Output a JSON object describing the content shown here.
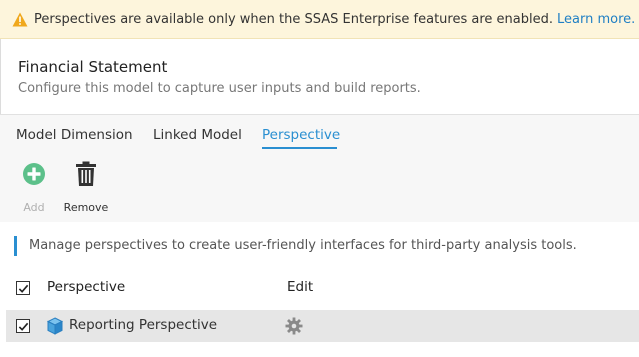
{
  "banner": {
    "icon": "warning-triangle-icon",
    "message": "Perspectives are available only when the SSAS Enterprise features are enabled.",
    "link_label": "Learn more.",
    "accent": "#f0a81c",
    "link_color": "#1f7fc4"
  },
  "model": {
    "title": "Financial Statement",
    "subtitle": "Configure this model to capture user inputs and build reports."
  },
  "tabs": [
    {
      "label": "Model Dimension",
      "active": false
    },
    {
      "label": "Linked Model",
      "active": false
    },
    {
      "label": "Perspective",
      "active": true
    }
  ],
  "toolbar": {
    "add_label": "Add",
    "add_icon": "plus-circle-icon",
    "remove_label": "Remove",
    "remove_icon": "trash-icon"
  },
  "info_text": "Manage perspectives to create user-friendly interfaces for third-party analysis tools.",
  "table": {
    "columns": [
      "Perspective",
      "Edit"
    ],
    "header_checked": true,
    "rows": [
      {
        "name": "Reporting Perspective",
        "checked": true,
        "icon": "cube-icon",
        "edit_icon": "gear-icon"
      }
    ]
  },
  "colors": {
    "active_tab": "#2a8fd1",
    "add_icon": "#5cc08a",
    "row_bg": "#e6e6e6"
  }
}
